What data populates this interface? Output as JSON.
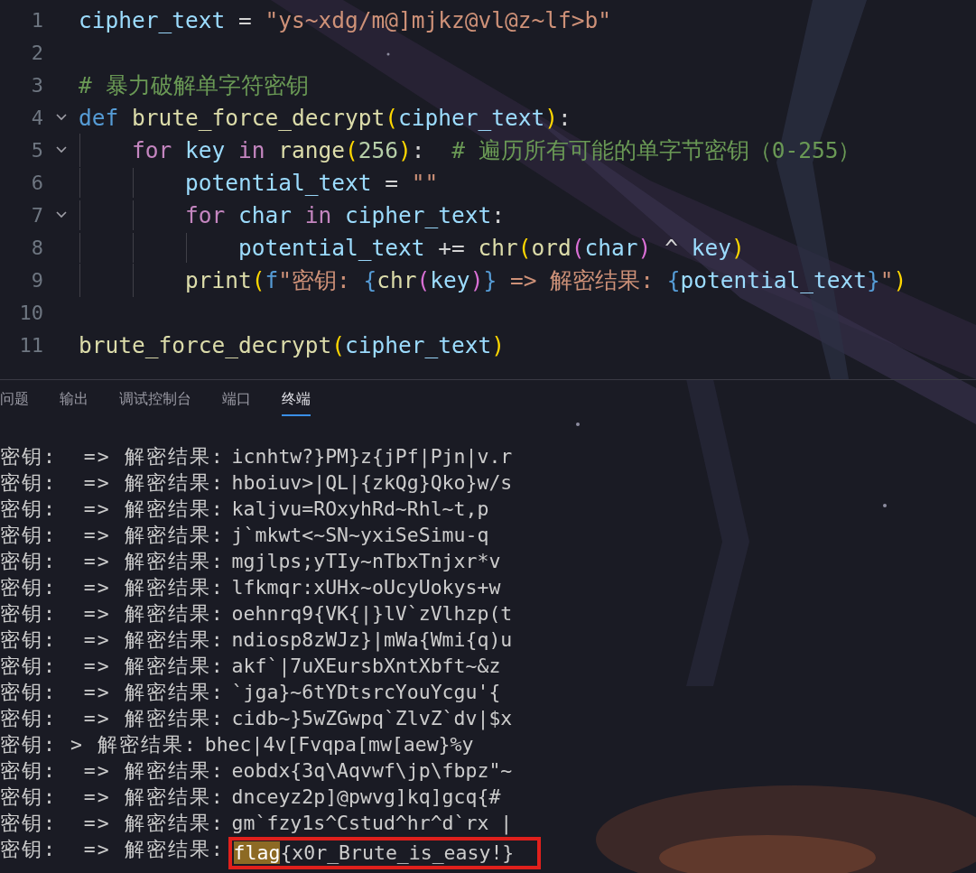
{
  "editor": {
    "lines": [
      {
        "number": "1",
        "fold": false,
        "tokens": [
          {
            "kind": "var",
            "text": "cipher_text"
          },
          {
            "kind": "op",
            "text": " = "
          },
          {
            "kind": "str",
            "text": "\"ys~xdg/m@]mjkz@vl@z~lf>b\""
          }
        ]
      },
      {
        "number": "2",
        "fold": false
      },
      {
        "number": "3",
        "fold": false,
        "tokens": [
          {
            "kind": "comment",
            "text": "# 暴力破解单字符密钥"
          }
        ]
      },
      {
        "number": "4",
        "fold": true,
        "tokens": [
          {
            "kind": "kw",
            "text": "def"
          },
          {
            "kind": "fn",
            "text": " brute_force_decrypt"
          },
          {
            "kind": "b1",
            "text": "("
          },
          {
            "kind": "var",
            "text": "cipher_text"
          },
          {
            "kind": "b1",
            "text": ")"
          },
          {
            "kind": "op",
            "text": ":"
          }
        ]
      },
      {
        "number": "5",
        "fold": true,
        "tokens": [
          {
            "kind": "ctrl",
            "text": "    for"
          },
          {
            "kind": "var",
            "text": " key"
          },
          {
            "kind": "ctrl",
            "text": " in"
          },
          {
            "kind": "fn",
            "text": " range"
          },
          {
            "kind": "b1",
            "text": "("
          },
          {
            "kind": "num",
            "text": "256"
          },
          {
            "kind": "b1",
            "text": ")"
          },
          {
            "kind": "op",
            "text": ":  "
          },
          {
            "kind": "comment",
            "text": "# 遍历所有可能的单字节密钥（0-255）"
          }
        ]
      },
      {
        "number": "6",
        "fold": false,
        "tokens": [
          {
            "kind": "var",
            "text": "        potential_text"
          },
          {
            "kind": "op",
            "text": " = "
          },
          {
            "kind": "str",
            "text": "\"\""
          }
        ]
      },
      {
        "number": "7",
        "fold": true,
        "tokens": [
          {
            "kind": "ctrl",
            "text": "        for"
          },
          {
            "kind": "var",
            "text": " char"
          },
          {
            "kind": "ctrl",
            "text": " in"
          },
          {
            "kind": "var",
            "text": " cipher_text"
          },
          {
            "kind": "op",
            "text": ":"
          }
        ]
      },
      {
        "number": "8",
        "fold": false,
        "tokens": [
          {
            "kind": "var",
            "text": "            potential_text"
          },
          {
            "kind": "op",
            "text": " += "
          },
          {
            "kind": "fn",
            "text": "chr"
          },
          {
            "kind": "b1",
            "text": "("
          },
          {
            "kind": "fn",
            "text": "ord"
          },
          {
            "kind": "b2",
            "text": "("
          },
          {
            "kind": "var",
            "text": "char"
          },
          {
            "kind": "b2",
            "text": ")"
          },
          {
            "kind": "op",
            "text": " ^ "
          },
          {
            "kind": "var",
            "text": "key"
          },
          {
            "kind": "b1",
            "text": ")"
          }
        ]
      },
      {
        "number": "9",
        "fold": false,
        "tokens": [
          {
            "kind": "fn",
            "text": "        print"
          },
          {
            "kind": "b1",
            "text": "("
          },
          {
            "kind": "kw",
            "text": "f"
          },
          {
            "kind": "str",
            "text": "\"密钥: "
          },
          {
            "kind": "kw",
            "text": "{"
          },
          {
            "kind": "fn",
            "text": "chr"
          },
          {
            "kind": "b2",
            "text": "("
          },
          {
            "kind": "var",
            "text": "key"
          },
          {
            "kind": "b2",
            "text": ")"
          },
          {
            "kind": "kw",
            "text": "}"
          },
          {
            "kind": "str",
            "text": " => 解密结果: "
          },
          {
            "kind": "kw",
            "text": "{"
          },
          {
            "kind": "var",
            "text": "potential_text"
          },
          {
            "kind": "kw",
            "text": "}"
          },
          {
            "kind": "str",
            "text": "\""
          },
          {
            "kind": "b1",
            "text": ")"
          }
        ]
      },
      {
        "number": "10",
        "fold": false
      },
      {
        "number": "11",
        "fold": false,
        "tokens": [
          {
            "kind": "fn",
            "text": "brute_force_decrypt"
          },
          {
            "kind": "b1",
            "text": "("
          },
          {
            "kind": "var",
            "text": "cipher_text"
          },
          {
            "kind": "b1",
            "text": ")"
          }
        ]
      }
    ]
  },
  "panel": {
    "tabs": [
      {
        "label": "问题",
        "selected": false
      },
      {
        "label": "输出",
        "selected": false
      },
      {
        "label": "调试控制台",
        "selected": false
      },
      {
        "label": "端口",
        "selected": false
      },
      {
        "label": "终端",
        "selected": true
      }
    ],
    "terminal": [
      {
        "prefix": "密钥:  => 解密结果:",
        "value": "icnhtw?}PM}z{jPf|Pjn|v.r",
        "boxed": false
      },
      {
        "prefix": "密钥:  => 解密结果:",
        "value": "hboiuv>|QL|{zkQg}Qko}w/s",
        "boxed": false
      },
      {
        "prefix": "密钥:  => 解密结果:",
        "value": "kaljvu=ROxyhRd~Rhl~t,p",
        "boxed": false
      },
      {
        "prefix": "密钥:  => 解密结果:",
        "value": "j`mkwt<~SN~yxiSeSimu-q",
        "boxed": false
      },
      {
        "prefix": "密钥:  => 解密结果:",
        "value": "mgjlps;yTIy~nTbxTnjxr*v",
        "boxed": false
      },
      {
        "prefix": "密钥:  => 解密结果:",
        "value": "lfkmqr:xUHx~oUcyUokys+w",
        "boxed": false
      },
      {
        "prefix": "密钥:  => 解密结果:",
        "value": "oehnrq9{VK{|}lV`zVlhzp(t",
        "boxed": false
      },
      {
        "prefix": "密钥:  => 解密结果:",
        "value": "ndiosp8zWJz}|mWa{Wmi{q)u",
        "boxed": false
      },
      {
        "prefix": "密钥:  => 解密结果:",
        "value": "akf`|7uXEursbXntXbft~&z",
        "boxed": false
      },
      {
        "prefix": "密钥:  => 解密结果:",
        "value": "`jga}~6tYDtsrcYouYcgu'{",
        "boxed": false
      },
      {
        "prefix": "密钥:  => 解密结果:",
        "value": "cidb~}5wZGwpq`ZlvZ`dv|$x",
        "boxed": false
      },
      {
        "prefix": "密钥: > 解密结果:",
        "value": "bhec|4v[Fvqpa[mw[aew}%y",
        "boxed": false
      },
      {
        "prefix": "密钥:  => 解密结果:",
        "value": "eobdx{3q\\Aqvwf\\jp\\fbpz\"~",
        "boxed": false
      },
      {
        "prefix": "密钥:  => 解密结果:",
        "value": "dnceyz2p]@pwvg]kq]gcq{#",
        "boxed": false
      },
      {
        "prefix": "密钥:  => 解密结果:",
        "value": "gm`fzy1s^Cstud^hr^d`rx |",
        "boxed": false
      },
      {
        "prefix": "密钥:  => 解密结果:",
        "match": "flag",
        "value": "{x0r_Brute_is_easy!}",
        "boxed": true
      }
    ]
  }
}
